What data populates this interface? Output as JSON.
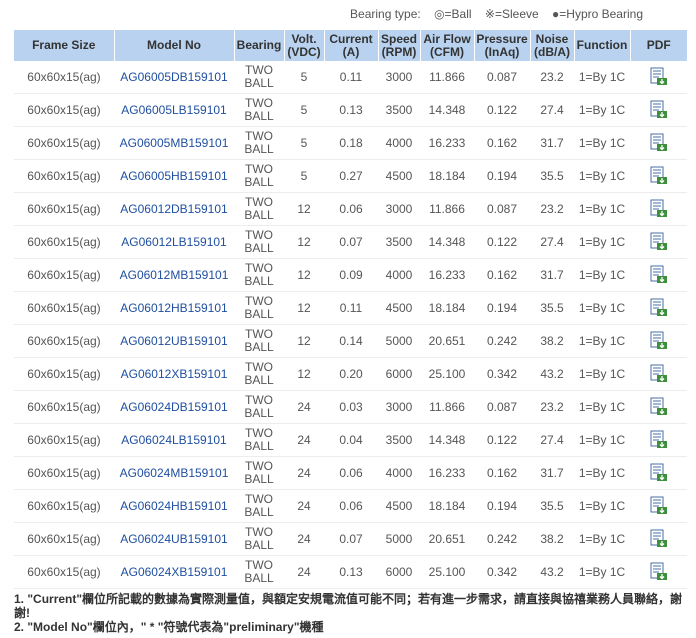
{
  "legend": {
    "label": "Bearing type:",
    "ball": "◎=Ball",
    "sleeve": "※=Sleeve",
    "hypro": "●=Hypro Bearing"
  },
  "headers": {
    "frame": "Frame Size",
    "model": "Model No",
    "bearing": "Bearing",
    "volt_1": "Volt.",
    "volt_2": "(VDC)",
    "current_1": "Current",
    "current_2": "(A)",
    "speed_1": "Speed",
    "speed_2": "(RPM)",
    "airflow_1": "Air Flow",
    "airflow_2": "(CFM)",
    "pressure_1": "Pressure",
    "pressure_2": "(InAq)",
    "noise_1": "Noise",
    "noise_2": "(dB/A)",
    "function": "Function",
    "pdf": "PDF"
  },
  "rows": [
    {
      "frame": "60x60x15(ag)",
      "model": "AG06005DB159101",
      "bearing_1": "TWO",
      "bearing_2": "BALL",
      "volt": "5",
      "current": "0.11",
      "speed": "3000",
      "airflow": "11.866",
      "pressure": "0.087",
      "noise": "23.2",
      "function": "1=By 1C"
    },
    {
      "frame": "60x60x15(ag)",
      "model": "AG06005LB159101",
      "bearing_1": "TWO",
      "bearing_2": "BALL",
      "volt": "5",
      "current": "0.13",
      "speed": "3500",
      "airflow": "14.348",
      "pressure": "0.122",
      "noise": "27.4",
      "function": "1=By 1C"
    },
    {
      "frame": "60x60x15(ag)",
      "model": "AG06005MB159101",
      "bearing_1": "TWO",
      "bearing_2": "BALL",
      "volt": "5",
      "current": "0.18",
      "speed": "4000",
      "airflow": "16.233",
      "pressure": "0.162",
      "noise": "31.7",
      "function": "1=By 1C"
    },
    {
      "frame": "60x60x15(ag)",
      "model": "AG06005HB159101",
      "bearing_1": "TWO",
      "bearing_2": "BALL",
      "volt": "5",
      "current": "0.27",
      "speed": "4500",
      "airflow": "18.184",
      "pressure": "0.194",
      "noise": "35.5",
      "function": "1=By 1C"
    },
    {
      "frame": "60x60x15(ag)",
      "model": "AG06012DB159101",
      "bearing_1": "TWO",
      "bearing_2": "BALL",
      "volt": "12",
      "current": "0.06",
      "speed": "3000",
      "airflow": "11.866",
      "pressure": "0.087",
      "noise": "23.2",
      "function": "1=By 1C"
    },
    {
      "frame": "60x60x15(ag)",
      "model": "AG06012LB159101",
      "bearing_1": "TWO",
      "bearing_2": "BALL",
      "volt": "12",
      "current": "0.07",
      "speed": "3500",
      "airflow": "14.348",
      "pressure": "0.122",
      "noise": "27.4",
      "function": "1=By 1C"
    },
    {
      "frame": "60x60x15(ag)",
      "model": "AG06012MB159101",
      "bearing_1": "TWO",
      "bearing_2": "BALL",
      "volt": "12",
      "current": "0.09",
      "speed": "4000",
      "airflow": "16.233",
      "pressure": "0.162",
      "noise": "31.7",
      "function": "1=By 1C"
    },
    {
      "frame": "60x60x15(ag)",
      "model": "AG06012HB159101",
      "bearing_1": "TWO",
      "bearing_2": "BALL",
      "volt": "12",
      "current": "0.11",
      "speed": "4500",
      "airflow": "18.184",
      "pressure": "0.194",
      "noise": "35.5",
      "function": "1=By 1C"
    },
    {
      "frame": "60x60x15(ag)",
      "model": "AG06012UB159101",
      "bearing_1": "TWO",
      "bearing_2": "BALL",
      "volt": "12",
      "current": "0.14",
      "speed": "5000",
      "airflow": "20.651",
      "pressure": "0.242",
      "noise": "38.2",
      "function": "1=By 1C"
    },
    {
      "frame": "60x60x15(ag)",
      "model": "AG06012XB159101",
      "bearing_1": "TWO",
      "bearing_2": "BALL",
      "volt": "12",
      "current": "0.20",
      "speed": "6000",
      "airflow": "25.100",
      "pressure": "0.342",
      "noise": "43.2",
      "function": "1=By 1C"
    },
    {
      "frame": "60x60x15(ag)",
      "model": "AG06024DB159101",
      "bearing_1": "TWO",
      "bearing_2": "BALL",
      "volt": "24",
      "current": "0.03",
      "speed": "3000",
      "airflow": "11.866",
      "pressure": "0.087",
      "noise": "23.2",
      "function": "1=By 1C"
    },
    {
      "frame": "60x60x15(ag)",
      "model": "AG06024LB159101",
      "bearing_1": "TWO",
      "bearing_2": "BALL",
      "volt": "24",
      "current": "0.04",
      "speed": "3500",
      "airflow": "14.348",
      "pressure": "0.122",
      "noise": "27.4",
      "function": "1=By 1C"
    },
    {
      "frame": "60x60x15(ag)",
      "model": "AG06024MB159101",
      "bearing_1": "TWO",
      "bearing_2": "BALL",
      "volt": "24",
      "current": "0.06",
      "speed": "4000",
      "airflow": "16.233",
      "pressure": "0.162",
      "noise": "31.7",
      "function": "1=By 1C"
    },
    {
      "frame": "60x60x15(ag)",
      "model": "AG06024HB159101",
      "bearing_1": "TWO",
      "bearing_2": "BALL",
      "volt": "24",
      "current": "0.06",
      "speed": "4500",
      "airflow": "18.184",
      "pressure": "0.194",
      "noise": "35.5",
      "function": "1=By 1C"
    },
    {
      "frame": "60x60x15(ag)",
      "model": "AG06024UB159101",
      "bearing_1": "TWO",
      "bearing_2": "BALL",
      "volt": "24",
      "current": "0.07",
      "speed": "5000",
      "airflow": "20.651",
      "pressure": "0.242",
      "noise": "38.2",
      "function": "1=By 1C"
    },
    {
      "frame": "60x60x15(ag)",
      "model": "AG06024XB159101",
      "bearing_1": "TWO",
      "bearing_2": "BALL",
      "volt": "24",
      "current": "0.13",
      "speed": "6000",
      "airflow": "25.100",
      "pressure": "0.342",
      "noise": "43.2",
      "function": "1=By 1C"
    }
  ],
  "pdf_icon": "pdf-download-icon",
  "colors": {
    "header_bg": "#b8d2f0",
    "model_link": "#1f4fa0"
  },
  "notes": {
    "note1": "1. \"Current\"欄位所記載的數據為實際測量值，與額定安規電流值可能不同；若有進一步需求，請直接與協禧業務人員聯絡，謝謝!",
    "note2": "2. \"Model No\"欄位內，\" * \"符號代表為\"preliminary\"機種"
  }
}
